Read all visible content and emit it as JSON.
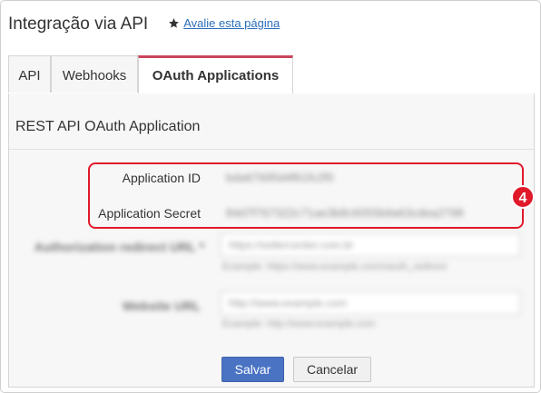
{
  "header": {
    "title": "Integração via API",
    "rate_link": "Avalie esta página"
  },
  "tabs": [
    {
      "label": "API"
    },
    {
      "label": "Webhooks"
    },
    {
      "label": "OAuth Applications",
      "active": true
    }
  ],
  "section": {
    "title": "REST API OAuth Application"
  },
  "fields": {
    "app_id": {
      "label": "Application ID",
      "value": "bda67695d4f61fc2f0"
    },
    "app_secret": {
      "label": "Application Secret",
      "value": "84d7f767322c71ae3b8c6055b9a63cdea2798"
    },
    "redirect": {
      "label": "Authorization redirect URL *",
      "value": "https://sellercenter.com.br",
      "help": "Example: https://www.example.com/oauth_redirect"
    },
    "website": {
      "label": "Website URL",
      "placeholder": "http://www.example.com",
      "help": "Example: http://www.example.com"
    }
  },
  "annotation": {
    "number": "4",
    "color": "#e0192b"
  },
  "actions": {
    "save": "Salvar",
    "cancel": "Cancelar"
  },
  "colors": {
    "accent_tab": "#c9455b",
    "primary_button": "#4a73c3",
    "link": "#2a6ebb"
  }
}
